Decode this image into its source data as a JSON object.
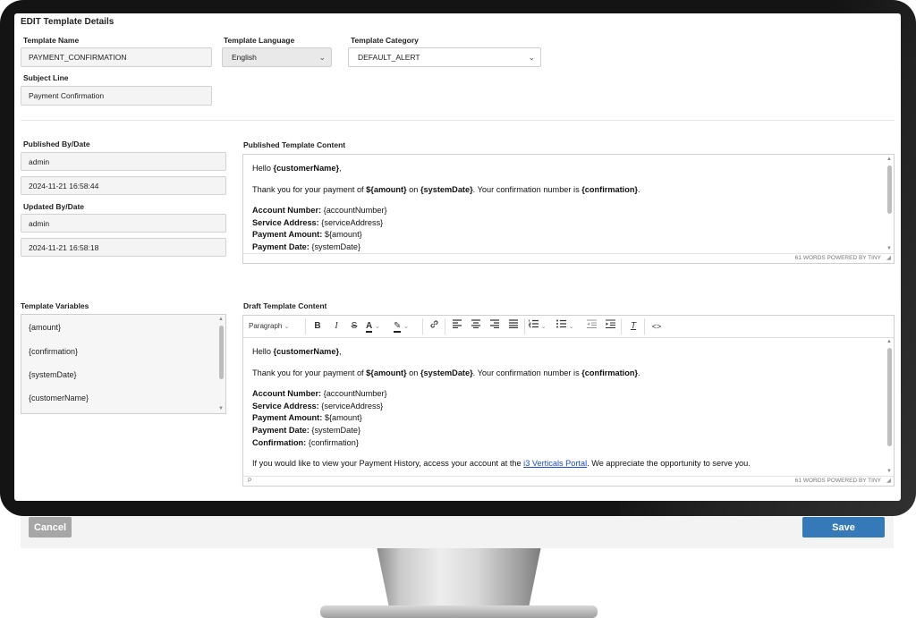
{
  "page_title": "EDIT Template Details",
  "fields": {
    "template_name": {
      "label": "Template Name",
      "value": "PAYMENT_CONFIRMATION"
    },
    "template_language": {
      "label": "Template Language",
      "value": "English"
    },
    "template_category": {
      "label": "Template Category",
      "value": "DEFAULT_ALERT"
    },
    "subject_line": {
      "label": "Subject Line",
      "value": "Payment Confirmation"
    }
  },
  "published": {
    "label": "Published By/Date",
    "by": "admin",
    "date": "2024-11-21 16:58:44"
  },
  "updated": {
    "label": "Updated By/Date",
    "by": "admin",
    "date": "2024-11-21 16:58:18"
  },
  "published_content": {
    "label": "Published Template Content",
    "hello": "Hello ",
    "hello_var": "{customerName}",
    "hello_end": ",",
    "thanks_1": "Thank you for your payment of ",
    "thanks_amount": "${amount}",
    "thanks_2": " on ",
    "thanks_date": "{systemDate}",
    "thanks_3": ".  Your confirmation number is ",
    "thanks_conf": "{confirmation}",
    "thanks_4": ".",
    "rows": [
      {
        "label": "Account Number:",
        "value": " {accountNumber}"
      },
      {
        "label": "Service Address:",
        "value": " {serviceAddress}"
      },
      {
        "label": "Payment Amount:",
        "value": " ${amount}"
      },
      {
        "label": "Payment Date:",
        "value": " {systemDate}"
      }
    ],
    "status_words": "61 WORDS  POWERED BY TINY"
  },
  "variables": {
    "label": "Template Variables",
    "items": [
      "{amount}",
      "{confirmation}",
      "{systemDate}",
      "{customerName}"
    ]
  },
  "draft_content": {
    "label": "Draft Template Content",
    "block_format": "Paragraph",
    "hello": "Hello ",
    "hello_var": "{customerName}",
    "hello_end": ",",
    "thanks_1": "Thank you for your payment of ",
    "thanks_amount": "${amount}",
    "thanks_2": " on ",
    "thanks_date": "{systemDate}",
    "thanks_3": ".  Your confirmation number is ",
    "thanks_conf": "{confirmation}",
    "thanks_4": ".",
    "rows": [
      {
        "label": "Account Number:",
        "value": " {accountNumber}"
      },
      {
        "label": "Service Address:",
        "value": " {serviceAddress}"
      },
      {
        "label": "Payment Amount:",
        "value": " ${amount}"
      },
      {
        "label": "Payment Date:",
        "value": " {systemDate}"
      },
      {
        "label": "Confirmation:",
        "value": " {confirmation}"
      }
    ],
    "history_1": "If you would like to view your Payment History, access your account at the ",
    "history_link": "i3 Verticals Portal",
    "history_2": ".  We appreciate the opportunity to serve you.",
    "status_path": "P",
    "status_words": "61 WORDS  POWERED BY TINY"
  },
  "toolbar": {
    "bold": "B",
    "italic": "I",
    "strike": "S",
    "font_color": "A",
    "link_glyph": "🔗",
    "clear_glyph": "T",
    "code_glyph": "<>"
  },
  "buttons": {
    "cancel": "Cancel",
    "save": "Save"
  },
  "colors": {
    "save": "#3679b8",
    "cancel": "#a6a6a6",
    "link": "#1a4dc7"
  }
}
